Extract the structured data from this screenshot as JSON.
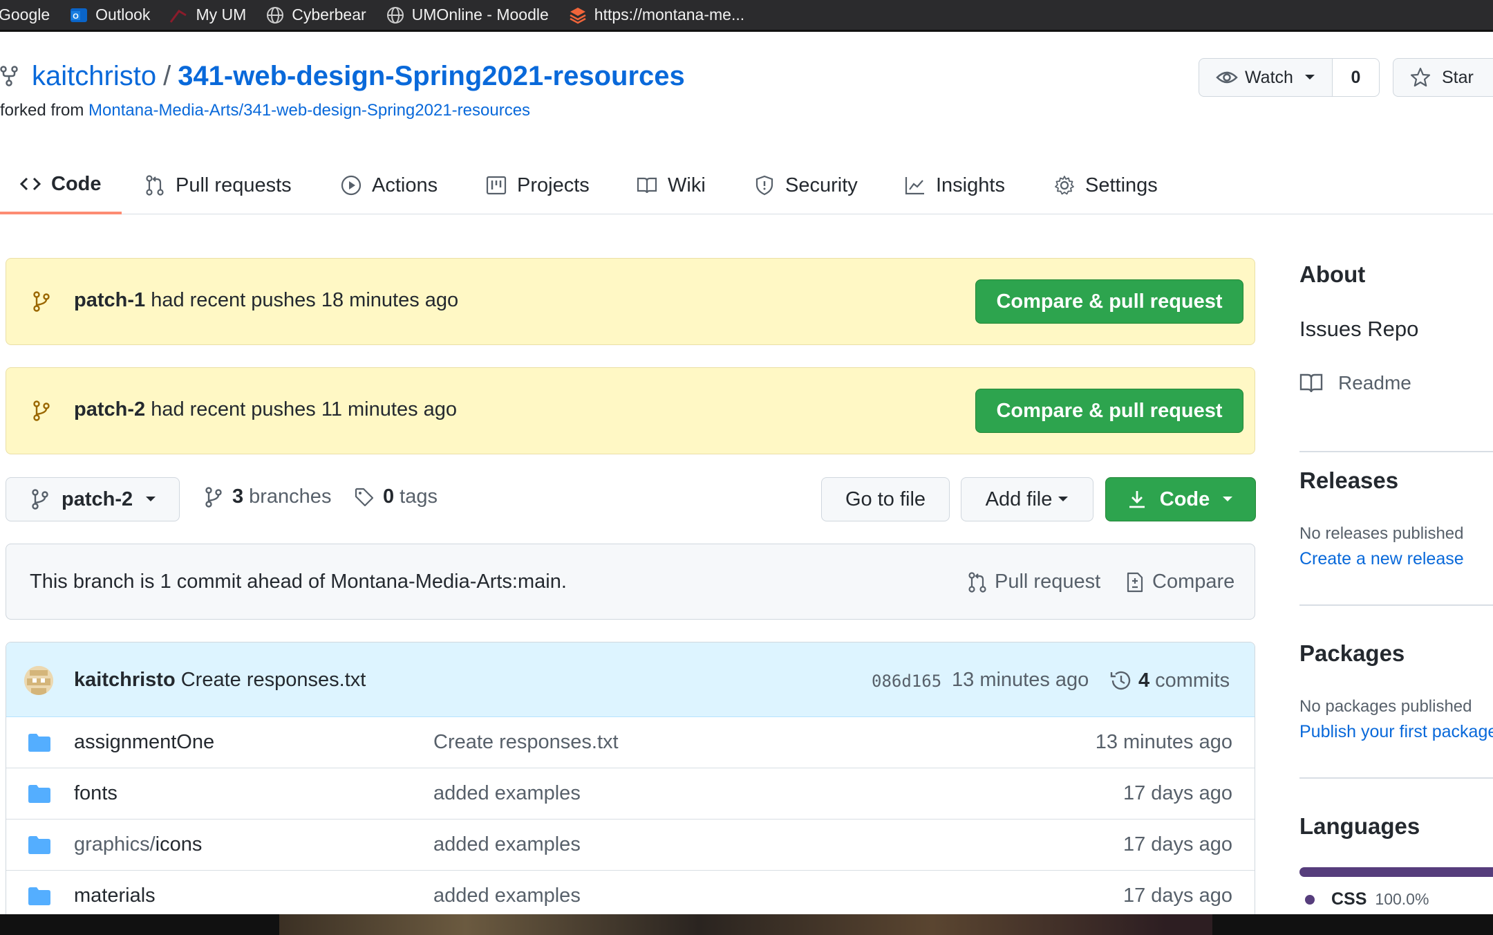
{
  "bookmarks": [
    {
      "label": "Google",
      "icon": "google-icon"
    },
    {
      "label": "Outlook",
      "icon": "outlook-icon"
    },
    {
      "label": "My UM",
      "icon": "um-icon"
    },
    {
      "label": "Cyberbear",
      "icon": "globe-icon"
    },
    {
      "label": "UMOnline - Moodle",
      "icon": "globe-icon"
    },
    {
      "label": "https://montana-me...",
      "icon": "layers-icon"
    }
  ],
  "repo": {
    "owner": "kaitchristo",
    "separator": "/",
    "name": "341-web-design-Spring2021-resources",
    "forked_prefix": "forked from ",
    "forked_from": "Montana-Media-Arts/341-web-design-Spring2021-resources",
    "watch_label": "Watch",
    "watch_count": "0",
    "star_label": "Star"
  },
  "tabs": [
    {
      "label": "Code",
      "icon": "code-icon",
      "active": true
    },
    {
      "label": "Pull requests",
      "icon": "pull-request-icon"
    },
    {
      "label": "Actions",
      "icon": "play-icon"
    },
    {
      "label": "Projects",
      "icon": "project-icon"
    },
    {
      "label": "Wiki",
      "icon": "book-icon"
    },
    {
      "label": "Security",
      "icon": "shield-icon"
    },
    {
      "label": "Insights",
      "icon": "graph-icon"
    },
    {
      "label": "Settings",
      "icon": "gear-icon"
    }
  ],
  "banners": [
    {
      "branch": "patch-1",
      "text": " had recent pushes 18 minutes ago",
      "button": "Compare & pull request"
    },
    {
      "branch": "patch-2",
      "text": " had recent pushes 11 minutes ago",
      "button": "Compare & pull request"
    }
  ],
  "branchbar": {
    "current_branch": "patch-2",
    "branches_count": "3",
    "branches_label": "branches",
    "tags_count": "0",
    "tags_label": "tags",
    "goto_file": "Go to file",
    "add_file": "Add file",
    "code": "Code"
  },
  "ahead": {
    "text": "This branch is 1 commit ahead of Montana-Media-Arts:main.",
    "pull_request": "Pull request",
    "compare": "Compare"
  },
  "latest_commit": {
    "author": "kaitchristo",
    "message": "Create responses.txt",
    "sha": "086d165",
    "time": "13 minutes ago",
    "commits_count": "4",
    "commits_label": "commits"
  },
  "files": [
    {
      "prefix": "",
      "name": "assignmentOne",
      "message": "Create responses.txt",
      "age": "13 minutes ago"
    },
    {
      "prefix": "",
      "name": "fonts",
      "message": "added examples",
      "age": "17 days ago"
    },
    {
      "prefix": "graphics/",
      "name": "icons",
      "message": "added examples",
      "age": "17 days ago"
    },
    {
      "prefix": "",
      "name": "materials",
      "message": "added examples",
      "age": "17 days ago"
    }
  ],
  "sidebar": {
    "about_title": "About",
    "description": "Issues Repo",
    "readme": "Readme",
    "releases_title": "Releases",
    "releases_none": "No releases published",
    "releases_link": "Create a new release",
    "packages_title": "Packages",
    "packages_none": "No packages published",
    "packages_link": "Publish your first package",
    "languages_title": "Languages",
    "language_name": "CSS",
    "language_pct": "100.0%",
    "language_color": "#563d7c"
  },
  "colors": {
    "link": "#0969da",
    "green": "#2da44e",
    "banner_bg": "#fff8c5",
    "active_tab": "#fd8c73"
  }
}
